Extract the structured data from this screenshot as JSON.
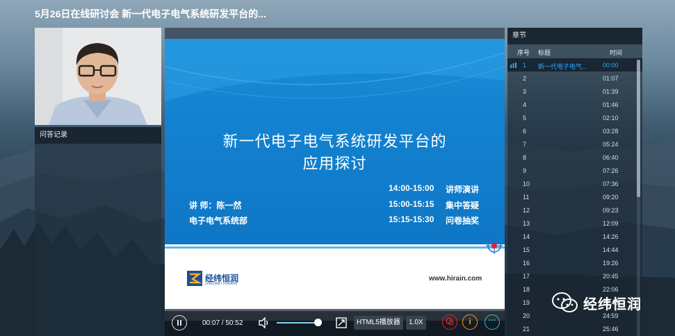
{
  "window": {
    "title": "5月26日在线研讨会 新一代电子电气系统研发平台的..."
  },
  "qa": {
    "header": "问答记录"
  },
  "slide": {
    "title_line1": "新一代电子电气系统研发平台的",
    "title_line2": "应用探讨",
    "schedule": [
      {
        "time": "14:00-15:00",
        "label": "讲师演讲"
      },
      {
        "time": "15:00-15:15",
        "label": "集中答疑"
      },
      {
        "time": "15:15-15:30",
        "label": "问卷抽奖"
      }
    ],
    "speaker": "讲 师：陈一然",
    "department": "电子电气系统部",
    "logo_text": "经纬恒润",
    "logo_sub": "JINGWEI HIRAIN",
    "url": "www.hirain.com"
  },
  "player": {
    "time_display": "00:07 / 50:52",
    "html5_label": "HTML5播放器",
    "speed_label": "1.0X",
    "volume_level": 0.85,
    "progress": 0.0023,
    "info_icon_glyph": "i",
    "more_icon_glyph": "···"
  },
  "chapters": {
    "header": "章节",
    "col_index": "序号",
    "col_title": "标题",
    "col_time": "时间",
    "rows": [
      {
        "idx": "1",
        "title": "新一代电子电气...",
        "time": "00:00"
      },
      {
        "idx": "2",
        "title": "",
        "time": "01:07"
      },
      {
        "idx": "3",
        "title": "",
        "time": "01:39"
      },
      {
        "idx": "4",
        "title": "",
        "time": "01:46"
      },
      {
        "idx": "5",
        "title": "",
        "time": "02:10"
      },
      {
        "idx": "6",
        "title": "",
        "time": "03:28"
      },
      {
        "idx": "7",
        "title": "",
        "time": "05:24"
      },
      {
        "idx": "8",
        "title": "",
        "time": "06:40"
      },
      {
        "idx": "9",
        "title": "",
        "time": "07:26"
      },
      {
        "idx": "10",
        "title": "",
        "time": "07:36"
      },
      {
        "idx": "11",
        "title": "",
        "time": "09:20"
      },
      {
        "idx": "12",
        "title": "",
        "time": "09:23"
      },
      {
        "idx": "13",
        "title": "",
        "time": "12:09"
      },
      {
        "idx": "14",
        "title": "",
        "time": "14:26"
      },
      {
        "idx": "15",
        "title": "",
        "time": "14:44"
      },
      {
        "idx": "16",
        "title": "",
        "time": "19:26"
      },
      {
        "idx": "17",
        "title": "",
        "time": "20:45"
      },
      {
        "idx": "18",
        "title": "",
        "time": "22:06"
      },
      {
        "idx": "19",
        "title": "",
        "time": "22:43"
      },
      {
        "idx": "20",
        "title": "",
        "time": "24:59"
      },
      {
        "idx": "21",
        "title": "",
        "time": "25:46"
      }
    ]
  },
  "watermark": {
    "text": "经纬恒润"
  },
  "colors": {
    "accent": "#2aa8ff",
    "slide_blue": "#1382d0",
    "brand_dark": "#1b4e93"
  }
}
